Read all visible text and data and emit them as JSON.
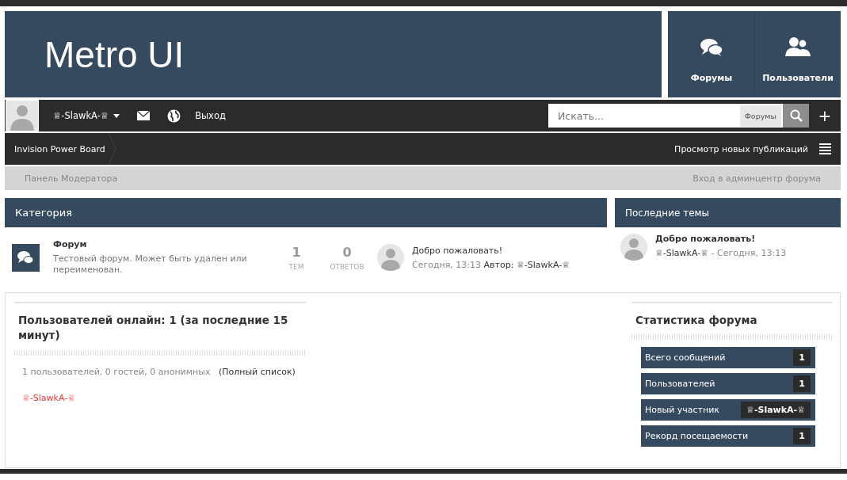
{
  "header": {
    "logo": "Metro UI",
    "tiles": [
      {
        "kind": "forums",
        "label": "Форумы"
      },
      {
        "kind": "users",
        "label": "Пользователи"
      }
    ]
  },
  "user_bar": {
    "username": "♕-SlawkA-♕",
    "logout": "Выход",
    "search": {
      "placeholder": "Искать...",
      "scope": "Форумы"
    },
    "add": "+"
  },
  "breadcrumb": {
    "crumb": "Invision Power Board",
    "new_posts": "Просмотр новых публикаций"
  },
  "mod_bar": {
    "left": "Панель Модератора",
    "right": "Вход в админцентр форума"
  },
  "category": {
    "title": "Категория",
    "forums": [
      {
        "name": "Форум",
        "description": "Тестовый форум. Может быть удален или переименован.",
        "topics": "1",
        "topics_label": "ТЕМ",
        "replies": "0",
        "replies_label": "ОТВЕТОВ",
        "last_title": "Добро пожаловать!",
        "last_time": "Сегодня, 13:13",
        "last_author_label": "Автор:",
        "last_author": "♕-SlawkA-♕"
      }
    ]
  },
  "latest_topics": {
    "title": "Последние темы",
    "items": [
      {
        "title": "Добро пожаловать!",
        "author": "♕-SlawkA-♕",
        "time": "- Сегодня, 13:13"
      }
    ]
  },
  "online": {
    "title": "Пользователей онлайн: 1 (за последние 15 минут)",
    "summary": "1 пользователей, 0 гостей, 0 анонимных",
    "full_list": "(Полный список)",
    "users": [
      "♕-SlawkA-♕"
    ]
  },
  "stats": {
    "title": "Статистика форума",
    "rows": [
      {
        "label": "Всего сообщений",
        "value": "1"
      },
      {
        "label": "Пользователей",
        "value": "1"
      },
      {
        "label": "Новый участник",
        "value": "♕-SlawkA-♕"
      },
      {
        "label": "Рекорд посещаемости",
        "value": "1"
      }
    ]
  }
}
